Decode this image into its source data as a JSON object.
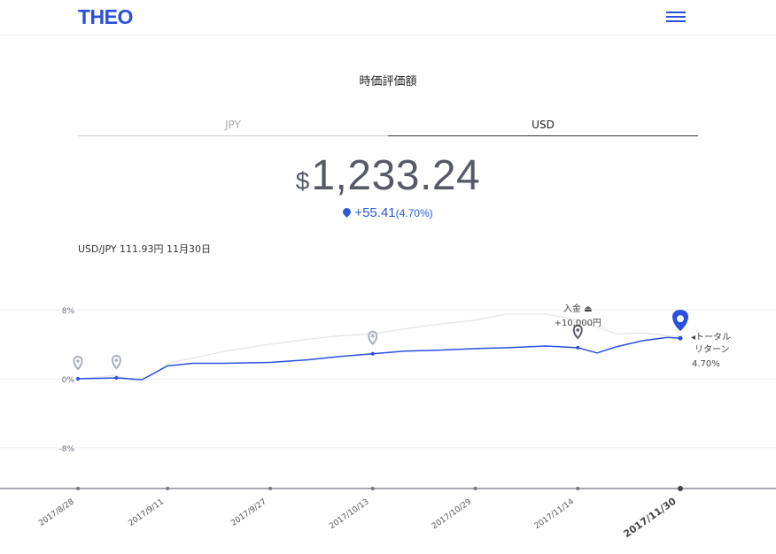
{
  "header": {
    "logo": "THEO"
  },
  "summary": {
    "title": "時価評価額",
    "tabs": [
      {
        "label": "JPY",
        "active": false
      },
      {
        "label": "USD",
        "active": true
      }
    ],
    "currency_symbol": "$",
    "amount": "1,233.24",
    "change_amount": "+55.41",
    "change_percent": "(4.70%)",
    "fx_note": "USD/JPY 111.93円 11月30日"
  },
  "colors": {
    "accent": "#2a4fdc",
    "secondary_line": "#e4e4ea",
    "marker": "#aab0bc",
    "text_muted": "#555a66"
  },
  "annotations": {
    "deposit_label": "入金 ⏏",
    "deposit_amount": "+10,000円",
    "total_return_line1": "◂トータル",
    "total_return_line2": "リターン",
    "total_return_value": "4.70%"
  },
  "chart_data": {
    "type": "line",
    "x": [
      "2017/8/28",
      "2017/9/3",
      "2017/9/7",
      "2017/9/11",
      "2017/9/15",
      "2017/9/20",
      "2017/9/27",
      "2017/10/3",
      "2017/10/8",
      "2017/10/13",
      "2017/10/18",
      "2017/10/23",
      "2017/10/29",
      "2017/11/3",
      "2017/11/9",
      "2017/11/14",
      "2017/11/17",
      "2017/11/20",
      "2017/11/24",
      "2017/11/28",
      "2017/11/30"
    ],
    "series": [
      {
        "values": [
          0.0,
          0.1,
          -0.1,
          1.5,
          1.8,
          1.8,
          1.9,
          2.2,
          2.6,
          2.9,
          3.2,
          3.3,
          3.5,
          3.6,
          3.8,
          3.6,
          3.0,
          3.7,
          4.4,
          4.8,
          4.7
        ]
      },
      {
        "values": [
          0.0,
          0.4,
          -0.5,
          1.8,
          2.4,
          3.2,
          4.0,
          4.6,
          5.0,
          5.2,
          5.8,
          6.3,
          6.8,
          7.5,
          7.5,
          6.8,
          6.0,
          5.2,
          5.3,
          5.0,
          4.9
        ]
      }
    ],
    "x_ticks": [
      "2017/8/28",
      "2017/9/11",
      "2017/9/27",
      "2017/10/13",
      "2017/10/29",
      "2017/11/14",
      "2017/11/30"
    ],
    "y_ticks": [
      "8%",
      "0%",
      "-8%"
    ],
    "y_tick_values": [
      8,
      0,
      -8
    ],
    "ylim": [
      -10,
      9
    ],
    "markers": [
      {
        "x": "2017/8/28",
        "y": 0.0
      },
      {
        "x": "2017/9/3",
        "y": 0.1
      },
      {
        "x": "2017/10/13",
        "y": 2.9
      },
      {
        "x": "2017/11/14",
        "y": 3.6
      }
    ],
    "current_point": {
      "x": "2017/11/30",
      "y": 4.7
    }
  }
}
